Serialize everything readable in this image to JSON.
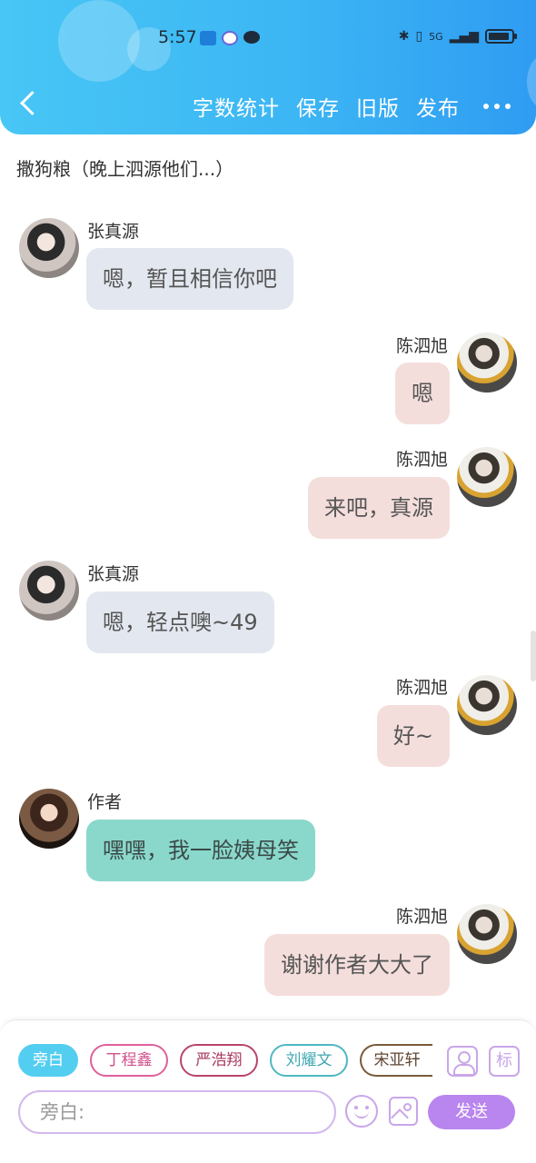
{
  "status_bar": {
    "time": "5:57",
    "network": "5G"
  },
  "header": {
    "actions": [
      "字数统计",
      "保存",
      "旧版",
      "发布"
    ]
  },
  "document": {
    "title": "撒狗粮（晚上泗源他们...）"
  },
  "messages": [
    {
      "side": "left",
      "speaker": "张真源",
      "text": "嗯，暂且相信你吧",
      "bubble_color": "#e3e7ef"
    },
    {
      "side": "right",
      "speaker": "陈泗旭",
      "text": "嗯",
      "bubble_color": "#f4dedc"
    },
    {
      "side": "right",
      "speaker": "陈泗旭",
      "text": "来吧，真源",
      "bubble_color": "#f4dedc"
    },
    {
      "side": "left",
      "speaker": "张真源",
      "text": "嗯，轻点噢~49",
      "bubble_color": "#e3e7ef"
    },
    {
      "side": "right",
      "speaker": "陈泗旭",
      "text": "好~",
      "bubble_color": "#f4dedc"
    },
    {
      "side": "left",
      "speaker": "作者",
      "text": "嘿嘿，我一脸姨母笑",
      "bubble_color": "#8ad8cb"
    },
    {
      "side": "right",
      "speaker": "陈泗旭",
      "text": "谢谢作者大大了",
      "bubble_color": "#f4dedc"
    }
  ],
  "composer": {
    "roles": [
      "旁白",
      "丁程鑫",
      "严浩翔",
      "刘耀文",
      "宋亚轩"
    ],
    "active_role": "旁白",
    "mark_label": "标",
    "input_placeholder": "旁白:",
    "send_label": "发送",
    "accent": "#b985ee"
  }
}
